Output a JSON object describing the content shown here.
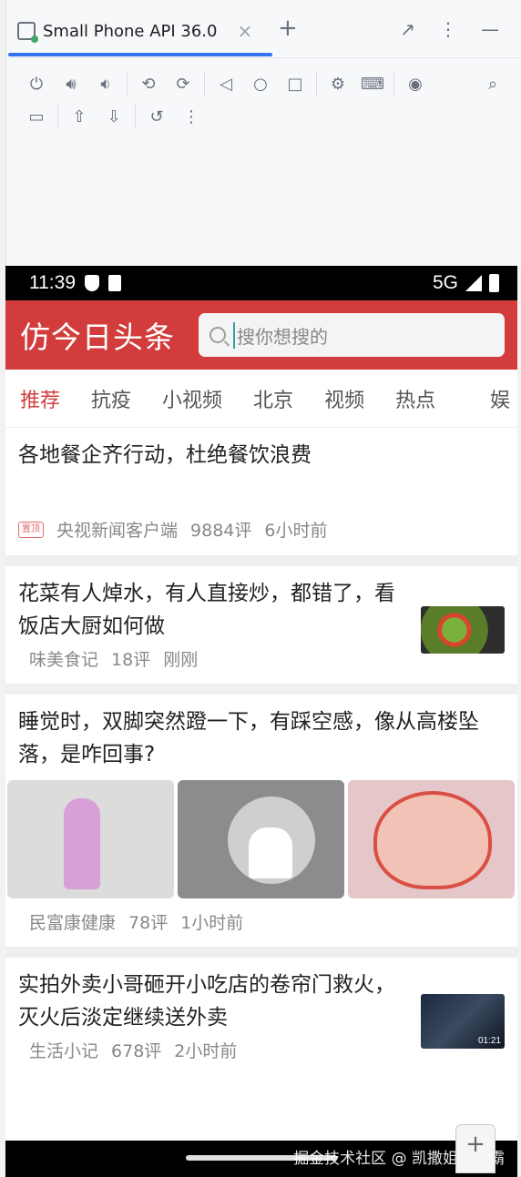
{
  "emulator": {
    "tab_title": "Small Phone API 36.0",
    "tab_close": "×",
    "tab_add": "+",
    "window_icons": [
      "↗",
      "⋮",
      "—"
    ],
    "toolbar_row1": [
      "power-icon",
      "volume-up-icon",
      "volume-down-icon",
      "rotate-left-icon",
      "rotate-right-icon",
      "back-icon",
      "home-icon",
      "overview-icon",
      "settings-icon",
      "keyboard-icon",
      "camera-icon",
      "zoom-icon"
    ],
    "toolbar_row2": [
      "record-icon",
      "upload-icon",
      "download-icon",
      "snapshot-icon",
      "more-icon"
    ]
  },
  "status_bar": {
    "time": "11:39",
    "network": "5G"
  },
  "header": {
    "title": "仿今日头条",
    "search_placeholder": "搜你想搜的"
  },
  "channels": [
    "推荐",
    "抗疫",
    "小视频",
    "北京",
    "视频",
    "热点",
    "娱"
  ],
  "news": [
    {
      "title": "各地餐企齐行动，杜绝餐饮浪费",
      "badge": "置顶",
      "source": "央视新闻客户端",
      "comments": "9884评",
      "time": "6小时前"
    },
    {
      "title": "花菜有人焯水，有人直接炒，都错了，看饭店大厨如何做",
      "source": "味美食记",
      "comments": "18评",
      "time": "刚刚"
    },
    {
      "title": "睡觉时，双脚突然蹬一下，有踩空感，像从高楼坠落，是咋回事?",
      "source": "民富康健康",
      "comments": "78评",
      "time": "1小时前"
    },
    {
      "title": "实拍外卖小哥砸开小吃店的卷帘门救火，灭火后淡定继续送外卖",
      "source": "生活小记",
      "comments": "678评",
      "time": "2小时前",
      "video_duration": "01:21"
    }
  ],
  "watermark": "掘金技术社区 @ 凯撒姐姐真霸",
  "fab_label": "+",
  "colors": {
    "header": "#d33c3c",
    "active_tab": "#d33c3c",
    "ide_accent": "#3574f0"
  }
}
